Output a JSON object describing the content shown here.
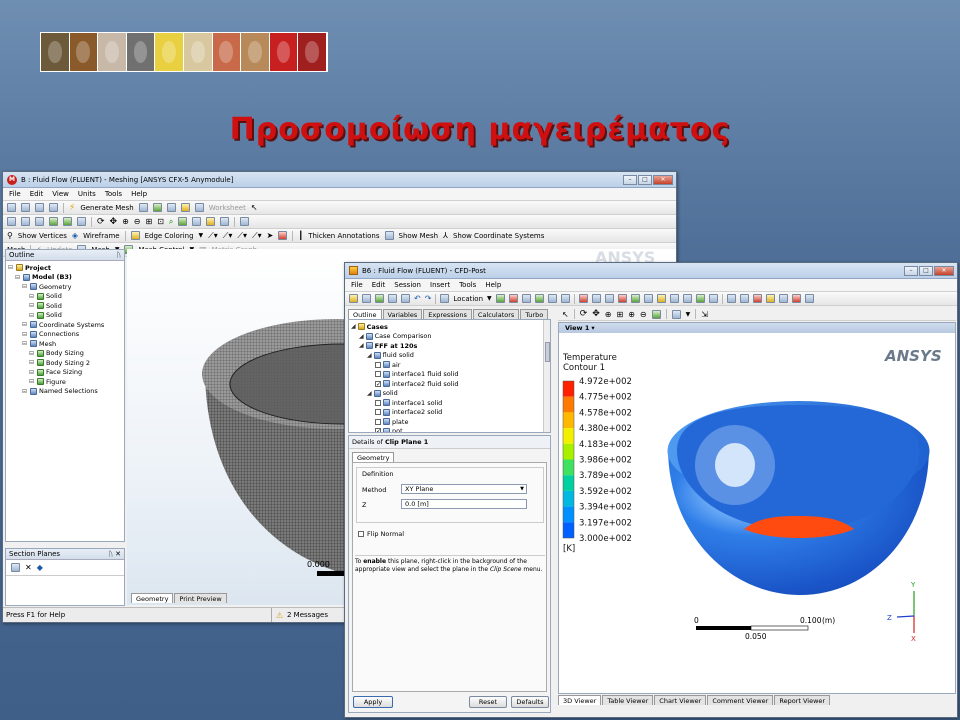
{
  "slide": {
    "title": "Προσομοίωση μαγειρέματος"
  },
  "logos": [
    {
      "name": "logo-jug",
      "color": "#6d5a3a"
    },
    {
      "name": "logo-vessel",
      "color": "#8a5a2a"
    },
    {
      "name": "logo-mineral",
      "color": "#c8b8a8"
    },
    {
      "name": "logo-microstructure",
      "color": "#707070"
    },
    {
      "name": "logo-yellow-blue",
      "color": "#e8d040"
    },
    {
      "name": "logo-pottery",
      "color": "#d8c8a0"
    },
    {
      "name": "logo-figure",
      "color": "#c86a4a"
    },
    {
      "name": "logo-map",
      "color": "#b88a5a"
    },
    {
      "name": "logo-seal",
      "color": "#c82020"
    },
    {
      "name": "logo-emblem",
      "color": "#a02020"
    }
  ],
  "meshing": {
    "title": "B : Fluid Flow (FLUENT) - Meshing [ANSYS CFX-5 Anymodule]",
    "menu": [
      "File",
      "Edit",
      "View",
      "Units",
      "Tools",
      "Help"
    ],
    "tb1": {
      "generate": "Generate Mesh",
      "worksheet": "Worksheet"
    },
    "tb2": {
      "show_vertices": "Show Vertices",
      "wireframe": "Wireframe",
      "edge_coloring": "Edge Coloring",
      "thicken": "Thicken Annotations",
      "show_mesh": "Show Mesh",
      "coord": "Show Coordinate Systems"
    },
    "tb3": {
      "mesh": "Mesh",
      "update": "Update",
      "mesh_dd": "Mesh",
      "mesh_control": "Mesh Control",
      "metric": "Metric Graph"
    },
    "outline": "Outline",
    "tree": [
      {
        "label": "Project",
        "lvl": 0,
        "bold": true
      },
      {
        "label": "Model (B3)",
        "lvl": 1,
        "bold": true
      },
      {
        "label": "Geometry",
        "lvl": 2
      },
      {
        "label": "Solid",
        "lvl": 3
      },
      {
        "label": "Solid",
        "lvl": 3
      },
      {
        "label": "Solid",
        "lvl": 3
      },
      {
        "label": "Coordinate Systems",
        "lvl": 2
      },
      {
        "label": "Connections",
        "lvl": 2
      },
      {
        "label": "Mesh",
        "lvl": 2
      },
      {
        "label": "Body Sizing",
        "lvl": 3
      },
      {
        "label": "Body Sizing 2",
        "lvl": 3
      },
      {
        "label": "Face Sizing",
        "lvl": 3
      },
      {
        "label": "Figure",
        "lvl": 3
      },
      {
        "label": "Named Selections",
        "lvl": 2
      }
    ],
    "section_planes": "Section Planes",
    "scale": "0.000",
    "tabs": [
      "Geometry",
      "Print Preview"
    ],
    "status_help": "Press F1 for Help",
    "status_msgs": "2 Messages",
    "brand": "ANSYS"
  },
  "cfdpost": {
    "title": "B6 : Fluid Flow (FLUENT) - CFD-Post",
    "menu": [
      "File",
      "Edit",
      "Session",
      "Insert",
      "Tools",
      "Help"
    ],
    "location": "Location",
    "panel_tabs": [
      "Outline",
      "Variables",
      "Expressions",
      "Calculators",
      "Turbo"
    ],
    "tree": [
      {
        "label": "Cases",
        "lvl": 0,
        "bold": true
      },
      {
        "label": "Case Comparison",
        "lvl": 1
      },
      {
        "label": "FFF at 120s",
        "lvl": 1,
        "bold": true
      },
      {
        "label": "fluid solid",
        "lvl": 2
      },
      {
        "label": "air",
        "lvl": 3,
        "ck": false
      },
      {
        "label": "interface1 fluid solid",
        "lvl": 3,
        "ck": false
      },
      {
        "label": "interface2 fluid solid",
        "lvl": 3,
        "ck": true
      },
      {
        "label": "solid",
        "lvl": 2
      },
      {
        "label": "interface1 solid",
        "lvl": 3,
        "ck": false
      },
      {
        "label": "interface2 solid",
        "lvl": 3,
        "ck": false
      },
      {
        "label": "plate",
        "lvl": 3,
        "ck": false
      },
      {
        "label": "pot",
        "lvl": 3,
        "ck": true
      }
    ],
    "details_prefix": "Details of ",
    "details_name": "Clip Plane 1",
    "geom_tab": "Geometry",
    "definition": "Definition",
    "method_label": "Method",
    "method_value": "XY Plane",
    "z_label": "Z",
    "z_value": "0.0 [m]",
    "flip": "Flip Normal",
    "hint_pre": "To ",
    "hint_bold": "enable",
    "hint_mid": " this plane, right-click in the background of the appropriate view and select the plane in the ",
    "hint_italic": "Clip Scene",
    "hint_post": " menu.",
    "apply": "Apply",
    "reset": "Reset",
    "defaults": "Defaults",
    "view_label": "View 1",
    "brand": "ANSYS",
    "legend_title1": "Temperature",
    "legend_title2": "Contour 1",
    "legend_values": [
      "4.972e+002",
      "4.775e+002",
      "4.578e+002",
      "4.380e+002",
      "4.183e+002",
      "3.986e+002",
      "3.789e+002",
      "3.592e+002",
      "3.394e+002",
      "3.197e+002",
      "3.000e+002"
    ],
    "legend_colors": [
      "#ff2000",
      "#ff7a00",
      "#ffb800",
      "#f2f000",
      "#a8f000",
      "#40e060",
      "#00d0a0",
      "#00b8e0",
      "#0090ff",
      "#0060ff",
      "#0040e8"
    ],
    "legend_unit": "[K]",
    "scale_start": "0",
    "scale_end": "0.100",
    "scale_unit": "(m)",
    "scale_mid": "0.050",
    "axes": {
      "x": "X",
      "y": "Y",
      "z": "Z"
    },
    "viewer_tabs": [
      "3D Viewer",
      "Table Viewer",
      "Chart Viewer",
      "Comment Viewer",
      "Report Viewer"
    ]
  },
  "colors": {
    "title": "#d01010",
    "plate": "#ff4a10",
    "pot": "#1a63d6"
  }
}
